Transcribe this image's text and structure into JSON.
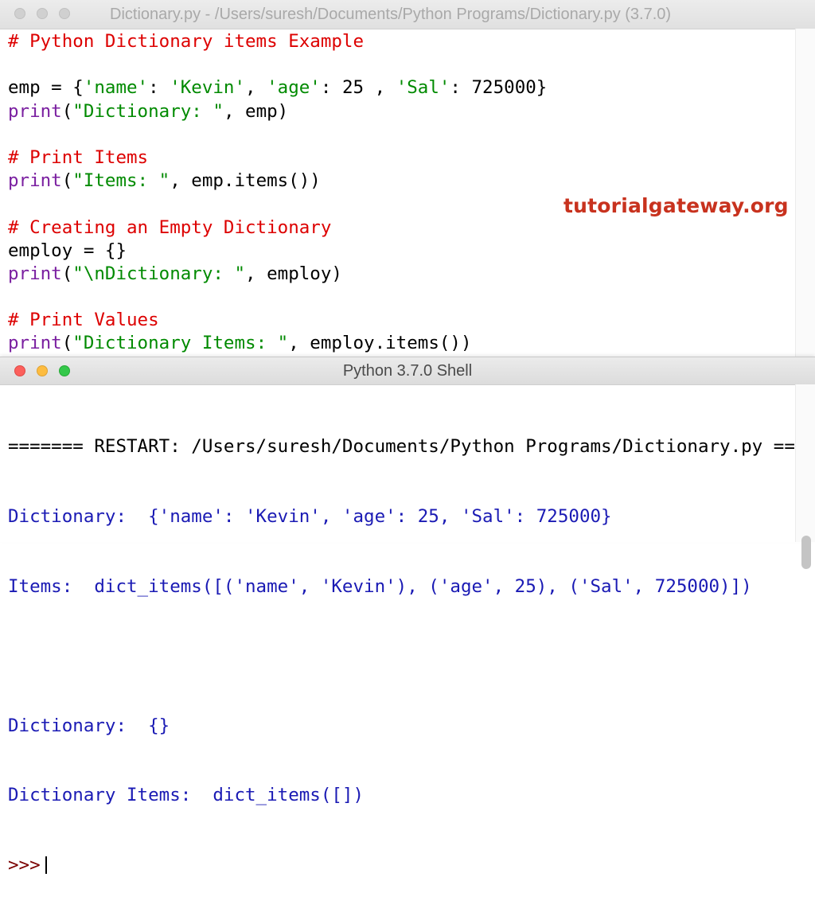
{
  "editor": {
    "title": "Dictionary.py - /Users/suresh/Documents/Python Programs/Dictionary.py (3.7.0)",
    "lines": [
      [
        {
          "t": "# Python Dictionary items Example",
          "c": "cmt"
        }
      ],
      [],
      [
        {
          "t": "emp = {",
          "c": "txt"
        },
        {
          "t": "'name'",
          "c": "str"
        },
        {
          "t": ": ",
          "c": "txt"
        },
        {
          "t": "'Kevin'",
          "c": "str"
        },
        {
          "t": ", ",
          "c": "txt"
        },
        {
          "t": "'age'",
          "c": "str"
        },
        {
          "t": ": 25 , ",
          "c": "txt"
        },
        {
          "t": "'Sal'",
          "c": "str"
        },
        {
          "t": ": 725000}",
          "c": "txt"
        }
      ],
      [
        {
          "t": "print",
          "c": "kw"
        },
        {
          "t": "(",
          "c": "txt"
        },
        {
          "t": "\"Dictionary: \"",
          "c": "str"
        },
        {
          "t": ", emp)",
          "c": "txt"
        }
      ],
      [],
      [
        {
          "t": "# Print Items",
          "c": "cmt"
        }
      ],
      [
        {
          "t": "print",
          "c": "kw"
        },
        {
          "t": "(",
          "c": "txt"
        },
        {
          "t": "\"Items: \"",
          "c": "str"
        },
        {
          "t": ", emp.items())",
          "c": "txt"
        }
      ],
      [],
      [
        {
          "t": "# Creating an Empty Dictionary",
          "c": "cmt"
        }
      ],
      [
        {
          "t": "employ = {}",
          "c": "txt"
        }
      ],
      [
        {
          "t": "print",
          "c": "kw"
        },
        {
          "t": "(",
          "c": "txt"
        },
        {
          "t": "\"\\nDictionary: \"",
          "c": "str"
        },
        {
          "t": ", employ)",
          "c": "txt"
        }
      ],
      [],
      [
        {
          "t": "# Print Values",
          "c": "cmt"
        }
      ],
      [
        {
          "t": "print",
          "c": "kw"
        },
        {
          "t": "(",
          "c": "txt"
        },
        {
          "t": "\"Dictionary Items: \"",
          "c": "str"
        },
        {
          "t": ", employ.items())",
          "c": "txt"
        }
      ]
    ]
  },
  "watermark": "tutorialgateway.org",
  "shell": {
    "title": "Python 3.7.0 Shell",
    "restart": "======= RESTART: /Users/suresh/Documents/Python Programs/Dictionary.py =======",
    "output": [
      "Dictionary:  {'name': 'Kevin', 'age': 25, 'Sal': 725000}",
      "Items:  dict_items([('name', 'Kevin'), ('age', 25), ('Sal', 725000)])",
      "",
      "Dictionary:  {}",
      "Dictionary Items:  dict_items([])"
    ],
    "prompt": ">>>"
  },
  "colors": {
    "comment": "#dd0000",
    "keyword": "#7a1fa0",
    "string": "#008a00",
    "stdout": "#1a1ab4",
    "watermark": "#c8321e"
  }
}
